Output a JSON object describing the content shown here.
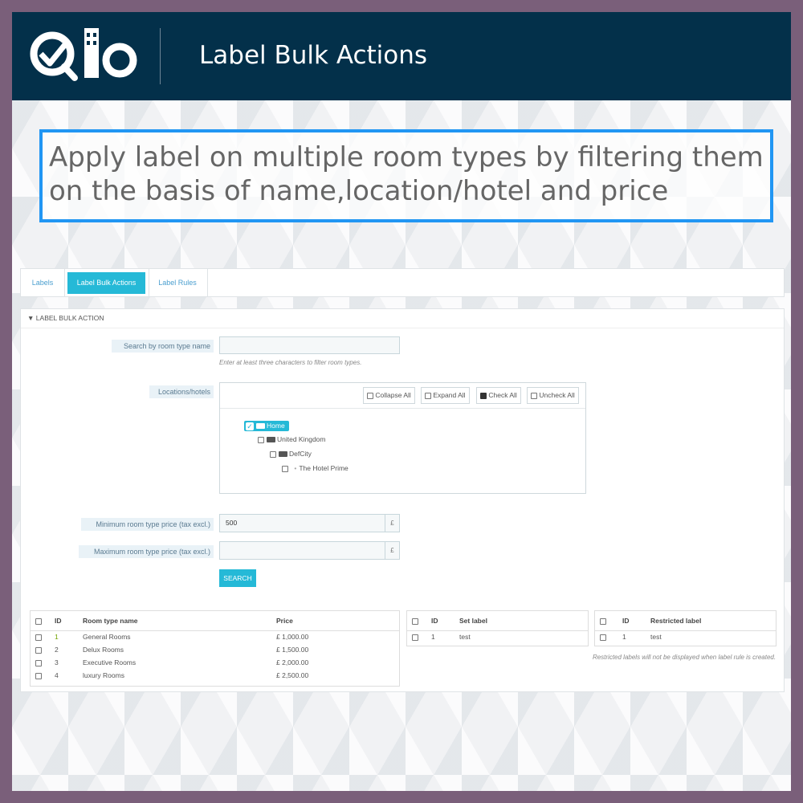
{
  "header": {
    "logo_text": "Qlo",
    "title": "Label Bulk Actions"
  },
  "callout": {
    "text": "Apply label on multiple room types by filtering them on the basis of name,location/hotel and price"
  },
  "tabs": [
    {
      "label": "Labels"
    },
    {
      "label": "Label Bulk Actions"
    },
    {
      "label": "Label Rules"
    }
  ],
  "panel": {
    "title": "LABEL BULK ACTION",
    "search_label": "Search by room type name",
    "search_value": "",
    "search_help": "Enter at least three characters to filter room types.",
    "locations_label": "Locations/hotels",
    "tree_buttons": {
      "collapse": "Collapse All",
      "expand": "Expand All",
      "check": "Check All",
      "uncheck": "Uncheck All"
    },
    "tree": {
      "home": "Home",
      "country": "United Kingdom",
      "city": "DefCity",
      "hotel": "The Hotel Prime"
    },
    "min_price_label": "Minimum room type price (tax excl.)",
    "min_price_value": "500",
    "max_price_label": "Maximum room type price (tax excl.)",
    "max_price_value": "",
    "currency": "£",
    "search_button": "SEARCH"
  },
  "rooms_table": {
    "headers": {
      "id": "ID",
      "name": "Room type name",
      "price": "Price"
    },
    "rows": [
      {
        "id": "1",
        "name": "General Rooms",
        "price": "£ 1,000.00"
      },
      {
        "id": "2",
        "name": "Delux Rooms",
        "price": "£ 1,500.00"
      },
      {
        "id": "3",
        "name": "Executive Rooms",
        "price": "£ 2,000.00"
      },
      {
        "id": "4",
        "name": "luxury Rooms",
        "price": "£ 2,500.00"
      }
    ]
  },
  "set_label_table": {
    "headers": {
      "id": "ID",
      "label": "Set label"
    },
    "rows": [
      {
        "id": "1",
        "label": "test"
      }
    ]
  },
  "restricted_table": {
    "headers": {
      "id": "ID",
      "label": "Restricted label"
    },
    "rows": [
      {
        "id": "1",
        "label": "test"
      }
    ],
    "note": "Restricted labels will not be displayed when label rule is created."
  },
  "colors": {
    "header_bg": "#03304a",
    "accent": "#25b9d7",
    "callout_border": "#2196f3",
    "page_border": "#7a5f7a"
  }
}
